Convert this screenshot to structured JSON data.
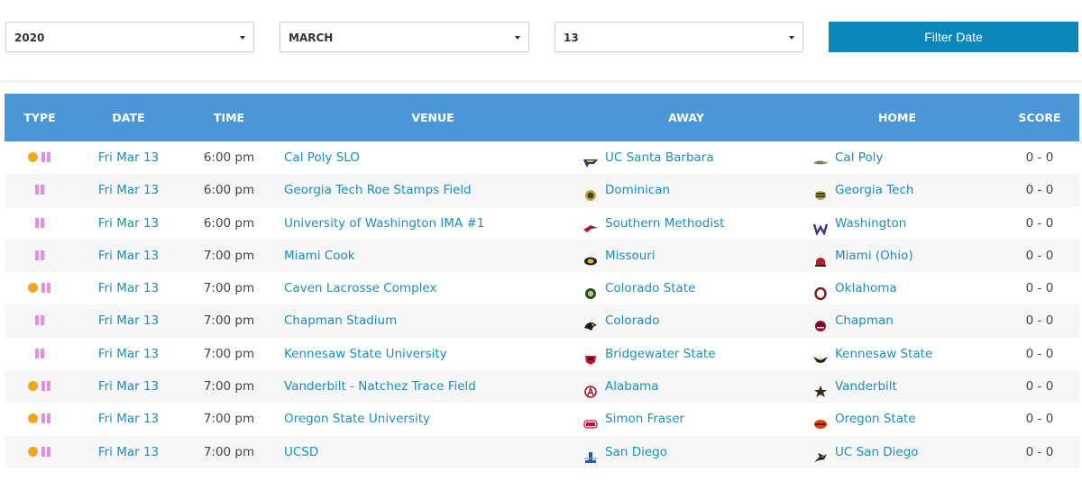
{
  "filters": {
    "year": "2020",
    "month": "MARCH",
    "day": "13",
    "button_label": "Filter Date"
  },
  "table": {
    "headers": [
      "TYPE",
      "DATE",
      "TIME",
      "VENUE",
      "AWAY",
      "HOME",
      "SCORE"
    ],
    "rows": [
      {
        "dot": true,
        "date": "Fri Mar 13",
        "time": "6:00 pm",
        "venue": "Cal Poly SLO",
        "away": "UC Santa Barbara",
        "away_logo": "uc-santa-barbara-logo-icon",
        "home": "Cal Poly",
        "home_logo": "cal-poly-logo-icon",
        "score": "0 - 0"
      },
      {
        "dot": false,
        "date": "Fri Mar 13",
        "time": "6:00 pm",
        "venue": "Georgia Tech Roe Stamps Field",
        "away": "Dominican",
        "away_logo": "dominican-logo-icon",
        "home": "Georgia Tech",
        "home_logo": "georgia-tech-logo-icon",
        "score": "0 - 0"
      },
      {
        "dot": false,
        "date": "Fri Mar 13",
        "time": "6:00 pm",
        "venue": "University of Washington IMA #1",
        "away": "Southern Methodist",
        "away_logo": "southern-methodist-logo-icon",
        "home": "Washington",
        "home_logo": "washington-logo-icon",
        "score": "0 - 0"
      },
      {
        "dot": false,
        "date": "Fri Mar 13",
        "time": "7:00 pm",
        "venue": "Miami Cook",
        "away": "Missouri",
        "away_logo": "missouri-logo-icon",
        "home": "Miami (Ohio)",
        "home_logo": "miami-ohio-logo-icon",
        "score": "0 - 0"
      },
      {
        "dot": true,
        "date": "Fri Mar 13",
        "time": "7:00 pm",
        "venue": "Caven Lacrosse Complex",
        "away": "Colorado State",
        "away_logo": "colorado-state-logo-icon",
        "home": "Oklahoma",
        "home_logo": "oklahoma-logo-icon",
        "score": "0 - 0"
      },
      {
        "dot": false,
        "date": "Fri Mar 13",
        "time": "7:00 pm",
        "venue": "Chapman Stadium",
        "away": "Colorado",
        "away_logo": "colorado-logo-icon",
        "home": "Chapman",
        "home_logo": "chapman-logo-icon",
        "score": "0 - 0"
      },
      {
        "dot": false,
        "date": "Fri Mar 13",
        "time": "7:00 pm",
        "venue": "Kennesaw State University",
        "away": "Bridgewater State",
        "away_logo": "bridgewater-state-logo-icon",
        "home": "Kennesaw State",
        "home_logo": "kennesaw-state-logo-icon",
        "score": "0 - 0"
      },
      {
        "dot": true,
        "date": "Fri Mar 13",
        "time": "7:00 pm",
        "venue": "Vanderbilt - Natchez Trace Field",
        "away": "Alabama",
        "away_logo": "alabama-logo-icon",
        "home": "Vanderbilt",
        "home_logo": "vanderbilt-logo-icon",
        "score": "0 - 0"
      },
      {
        "dot": true,
        "date": "Fri Mar 13",
        "time": "7:00 pm",
        "venue": "Oregon State University",
        "away": "Simon Fraser",
        "away_logo": "simon-fraser-logo-icon",
        "home": "Oregon State",
        "home_logo": "oregon-state-logo-icon",
        "score": "0 - 0"
      },
      {
        "dot": true,
        "date": "Fri Mar 13",
        "time": "7:00 pm",
        "venue": "UCSD",
        "away": "San Diego",
        "away_logo": "san-diego-logo-icon",
        "home": "UC San Diego",
        "home_logo": "uc-san-diego-logo-icon",
        "score": "0 - 0"
      }
    ]
  },
  "colors": {
    "header_bg": "#4a96d6",
    "button_bg": "#0a87b8",
    "link": "#1a8fc0",
    "dot": "#f2a51e",
    "pause": "#ea8be2"
  }
}
